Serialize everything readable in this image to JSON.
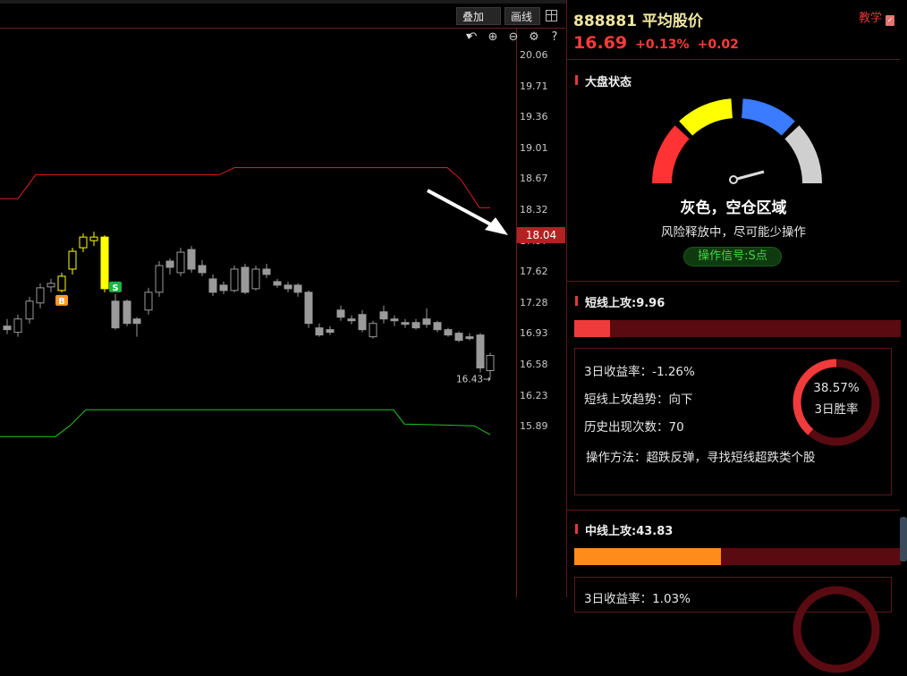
{
  "toolbar": {
    "overlay_label": "叠加",
    "draw_label": "画线"
  },
  "chart": {
    "price_ticks": [
      "20.06",
      "19.71",
      "19.36",
      "19.01",
      "18.67",
      "18.32",
      "17.97",
      "17.62",
      "17.28",
      "16.93",
      "16.58",
      "16.23",
      "15.89"
    ],
    "current_price_tag": "18.04",
    "low_price_label": "16.43",
    "buy_marker": "B",
    "sell_marker": "S",
    "colors": {
      "up": "#ffff00",
      "down": "#ffff00",
      "grey": "#9a9a9a",
      "upper_band": "#e0201e",
      "lower_band": "#22c322",
      "tag_bg": "#b22222"
    }
  },
  "header": {
    "code": "888881",
    "name": "平均股价",
    "price": "16.69",
    "change_pct": "+0.13%",
    "change": "+0.02",
    "teach_label": "教学"
  },
  "market": {
    "title": "大盘状态",
    "status": "灰色，空仓区域",
    "advice": "风险释放中，尽可能少操作",
    "signal": "操作信号:S点",
    "gauge_colors": [
      "#ff3333",
      "#ffff00",
      "#3b7bff",
      "#cfcfcf"
    ]
  },
  "short": {
    "title": "短线上攻:9.96",
    "progress": 0.11,
    "return_3d": "3日收益率：-1.26%",
    "trend": "短线上攻趋势：向下",
    "occurrences": "历史出现次数：70",
    "method": "操作方法：超跌反弹，寻找短线超跌类个股",
    "win_rate": "38.57%",
    "win_rate_value": 0.3857,
    "win_label": "3日胜率"
  },
  "mid": {
    "title": "中线上攻:43.83",
    "progress": 0.45,
    "return_3d": "3日收益率：1.03%"
  }
}
